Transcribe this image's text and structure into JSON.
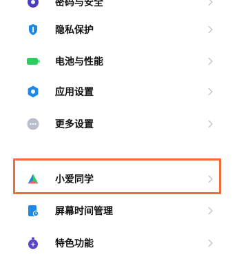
{
  "settings": {
    "items": [
      {
        "label": "密码与安全",
        "icon": "lock-icon"
      },
      {
        "label": "隐私保护",
        "icon": "shield-icon"
      },
      {
        "label": "电池与性能",
        "icon": "battery-icon"
      },
      {
        "label": "应用设置",
        "icon": "gear-icon"
      },
      {
        "label": "更多设置",
        "icon": "more-icon"
      },
      {
        "label": "小爱同学",
        "icon": "xiaoai-icon"
      },
      {
        "label": "屏幕时间管理",
        "icon": "screen-time-icon"
      },
      {
        "label": "特色功能",
        "icon": "feature-icon"
      }
    ]
  },
  "highlight": {
    "target": "小爱同学",
    "color": "#ef6b3a"
  },
  "colors": {
    "blue": "#1e88e5",
    "green": "#2ecc5e",
    "gray": "#b8bccd",
    "purple": "#5a47c8"
  }
}
